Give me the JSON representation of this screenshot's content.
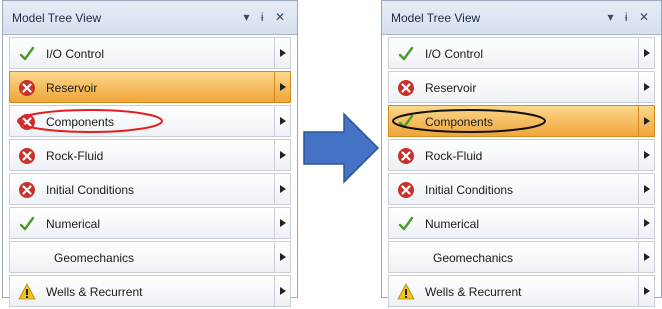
{
  "panels": [
    {
      "title": "Model Tree View",
      "controls": [
        "▾",
        "ɨ",
        "✕"
      ],
      "items": [
        {
          "label": "I/O Control",
          "icon": "check-icon"
        },
        {
          "label": "Reservoir",
          "icon": "error-icon"
        },
        {
          "label": "Components",
          "icon": "error-icon"
        },
        {
          "label": "Rock-Fluid",
          "icon": "error-icon"
        },
        {
          "label": "Initial Conditions",
          "icon": "error-icon"
        },
        {
          "label": "Numerical",
          "icon": "check-icon"
        },
        {
          "label": "Geomechanics",
          "icon": "none"
        },
        {
          "label": "Wells & Recurrent",
          "icon": "warning-icon"
        }
      ],
      "selected": "Reservoir",
      "highlight": "Components",
      "highlight_color": "#e02020"
    },
    {
      "title": "Model Tree View",
      "controls": [
        "▾",
        "ɨ",
        "✕"
      ],
      "items": [
        {
          "label": "I/O Control",
          "icon": "check-icon"
        },
        {
          "label": "Reservoir",
          "icon": "error-icon"
        },
        {
          "label": "Components",
          "icon": "check-icon"
        },
        {
          "label": "Rock-Fluid",
          "icon": "error-icon"
        },
        {
          "label": "Initial Conditions",
          "icon": "error-icon"
        },
        {
          "label": "Numerical",
          "icon": "check-icon"
        },
        {
          "label": "Geomechanics",
          "icon": "none"
        },
        {
          "label": "Wells & Recurrent",
          "icon": "warning-icon"
        }
      ],
      "selected": "Components",
      "highlight": "Components",
      "highlight_color": "#111111"
    }
  ],
  "colors": {
    "selected": "#f0a63a",
    "check": "#4a9a2a",
    "error": "#c8322b",
    "warning": "#f2c21b",
    "arrow": "#4472c4"
  }
}
